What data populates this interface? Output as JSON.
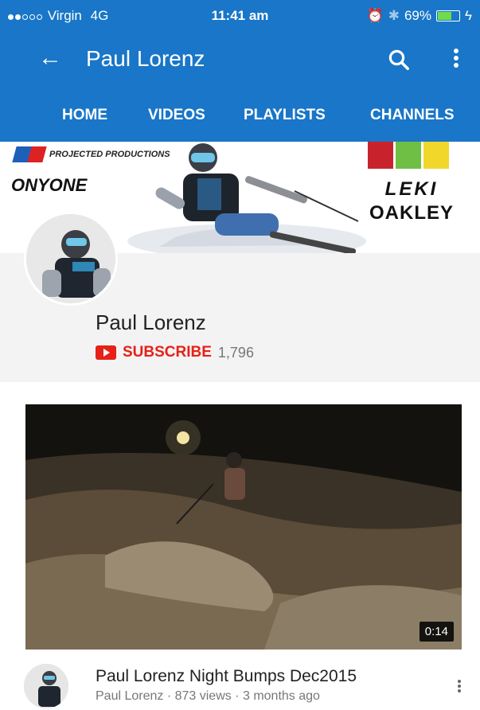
{
  "status_bar": {
    "carrier": "Virgin",
    "network": "4G",
    "time": "11:41 am",
    "battery": "69%"
  },
  "app_bar": {
    "title": "Paul Lorenz",
    "icons": [
      "back-arrow-icon",
      "search-icon",
      "more-vert-icon"
    ]
  },
  "tabs": [
    "HOME",
    "VIDEOS",
    "PLAYLISTS",
    "CHANNELS"
  ],
  "banner": {
    "sponsor_1": "PROJECTED PRODUCTIONS",
    "sponsor_2": "ONYONE",
    "sponsor_3": "LEKI",
    "sponsor_4": "OAKLEY"
  },
  "channel": {
    "name": "Paul Lorenz",
    "subscribe_label": "SUBSCRIBE",
    "subscriber_count": "1,796"
  },
  "video": {
    "duration": "0:14",
    "title": "Paul Lorenz Night Bumps Dec2015",
    "meta": "Paul Lorenz · 873 views · 3 months ago"
  },
  "colors": {
    "app_bar": "#1976c8",
    "subscribe_red": "#e62117",
    "profile_bg": "#f3f3f3"
  }
}
